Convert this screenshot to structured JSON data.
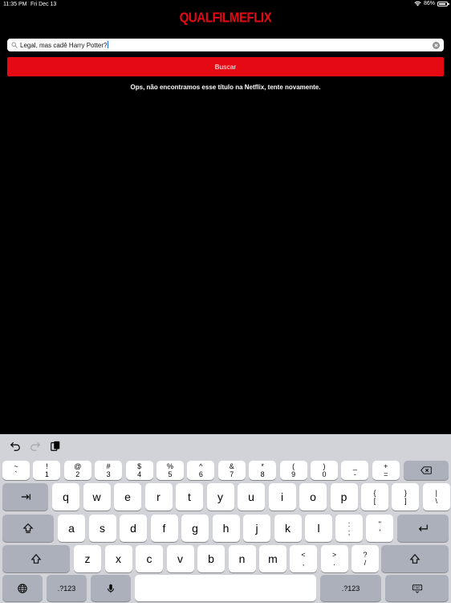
{
  "status_bar": {
    "time": "11:35 PM",
    "date": "Fri Dec 13",
    "battery": "86%",
    "battery_level": 0.86
  },
  "app": {
    "logo": "QUALFILMEFLIX"
  },
  "search": {
    "value": "Legal, mas cadê Harry Potter?",
    "button_label": "Buscar"
  },
  "message": "Ops, não encontramos esse título na Netflix, tente novamente.",
  "colors": {
    "brand": "#e50914",
    "background": "#000000",
    "keyboard": "#d1d3d9"
  },
  "keyboard": {
    "toolbar": [
      "undo-icon",
      "redo-icon",
      "paste-icon"
    ],
    "number_row": [
      {
        "top": "~",
        "bottom": "`"
      },
      {
        "top": "!",
        "bottom": "1"
      },
      {
        "top": "@",
        "bottom": "2"
      },
      {
        "top": "#",
        "bottom": "3"
      },
      {
        "top": "$",
        "bottom": "4"
      },
      {
        "top": "%",
        "bottom": "5"
      },
      {
        "top": "^",
        "bottom": "6"
      },
      {
        "top": "&",
        "bottom": "7"
      },
      {
        "top": "*",
        "bottom": "8"
      },
      {
        "top": "(",
        "bottom": "9"
      },
      {
        "top": ")",
        "bottom": "0"
      },
      {
        "top": "_",
        "bottom": "-"
      },
      {
        "top": "+",
        "bottom": "="
      }
    ],
    "row1": [
      "q",
      "w",
      "e",
      "r",
      "t",
      "y",
      "u",
      "i",
      "o",
      "p"
    ],
    "row1_extra": [
      {
        "top": "{",
        "bottom": "["
      },
      {
        "top": "}",
        "bottom": "]"
      },
      {
        "top": "|",
        "bottom": "\\"
      }
    ],
    "row2": [
      "a",
      "s",
      "d",
      "f",
      "g",
      "h",
      "j",
      "k",
      "l"
    ],
    "row2_extra": [
      {
        "top": ":",
        "bottom": ";"
      },
      {
        "top": "\"",
        "bottom": "'"
      }
    ],
    "row3": [
      "z",
      "x",
      "c",
      "v",
      "b",
      "n",
      "m"
    ],
    "row3_extra": [
      {
        "top": "<",
        "bottom": ","
      },
      {
        "top": ">",
        "bottom": "."
      },
      {
        "top": "?",
        "bottom": "/"
      }
    ],
    "numbers_label": ".?123"
  }
}
